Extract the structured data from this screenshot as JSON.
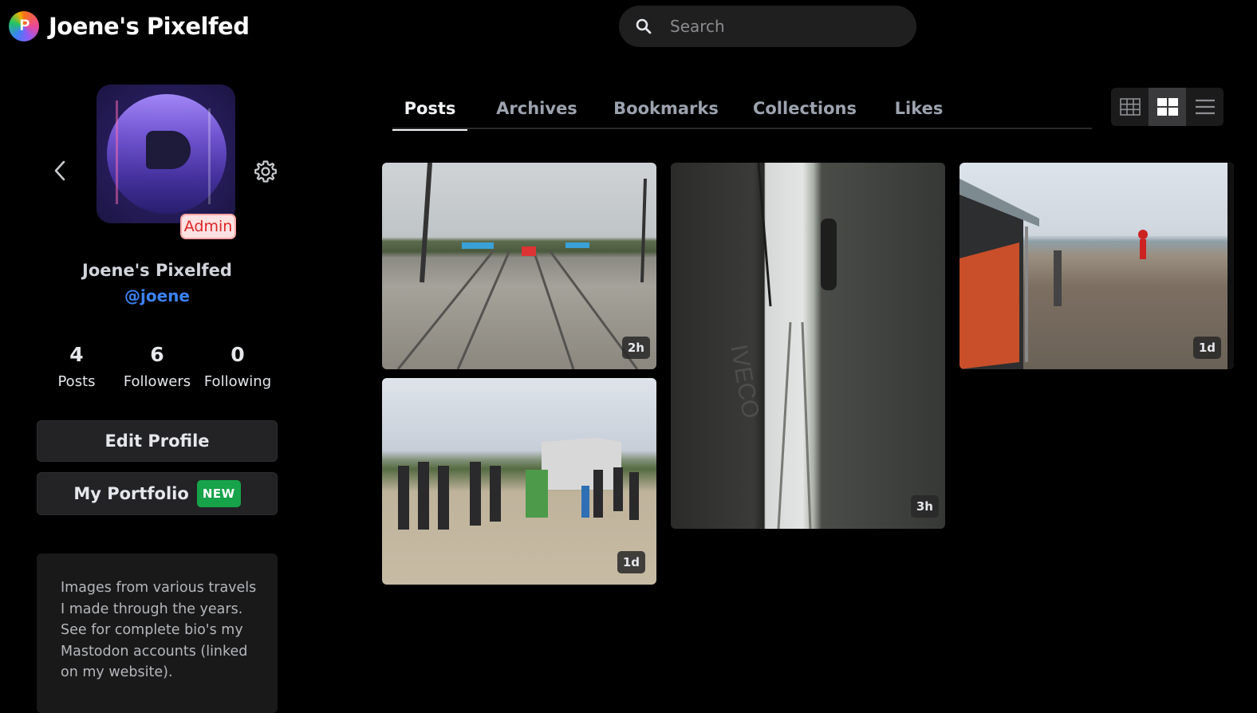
{
  "header": {
    "logo_letter": "P",
    "site_title": "Joene's Pixelfed",
    "search_placeholder": "Search"
  },
  "profile": {
    "badge": "Admin",
    "display_name": "Joene's Pixelfed",
    "username": "@joene",
    "stats": [
      {
        "value": "4",
        "label": "Posts"
      },
      {
        "value": "6",
        "label": "Followers"
      },
      {
        "value": "0",
        "label": "Following"
      }
    ],
    "edit_profile_label": "Edit Profile",
    "portfolio_label": "My Portfolio",
    "portfolio_badge": "NEW",
    "bio": "Images from various travels I made through the years. See for complete bio's my Mastodon accounts (linked on my website)."
  },
  "tabs": [
    {
      "label": "Posts",
      "active": true
    },
    {
      "label": "Archives",
      "active": false
    },
    {
      "label": "Bookmarks",
      "active": false
    },
    {
      "label": "Collections",
      "active": false
    },
    {
      "label": "Likes",
      "active": false
    }
  ],
  "view_modes": [
    "grid-3-icon",
    "grid-2-icon",
    "list-icon"
  ],
  "active_view": "grid-2-icon",
  "posts": [
    {
      "time": "2h",
      "subject": "railway tracks with tents"
    },
    {
      "time": "3h",
      "subject": "side of truck along tracks"
    },
    {
      "time": "1d",
      "subject": "people near fence and tents"
    },
    {
      "time": "1d",
      "subject": "crowd near a truck"
    }
  ],
  "colors": {
    "background": "#000000",
    "accent_link": "#3b82f6",
    "admin_badge": "#dc2626",
    "new_badge": "#16a34a"
  }
}
